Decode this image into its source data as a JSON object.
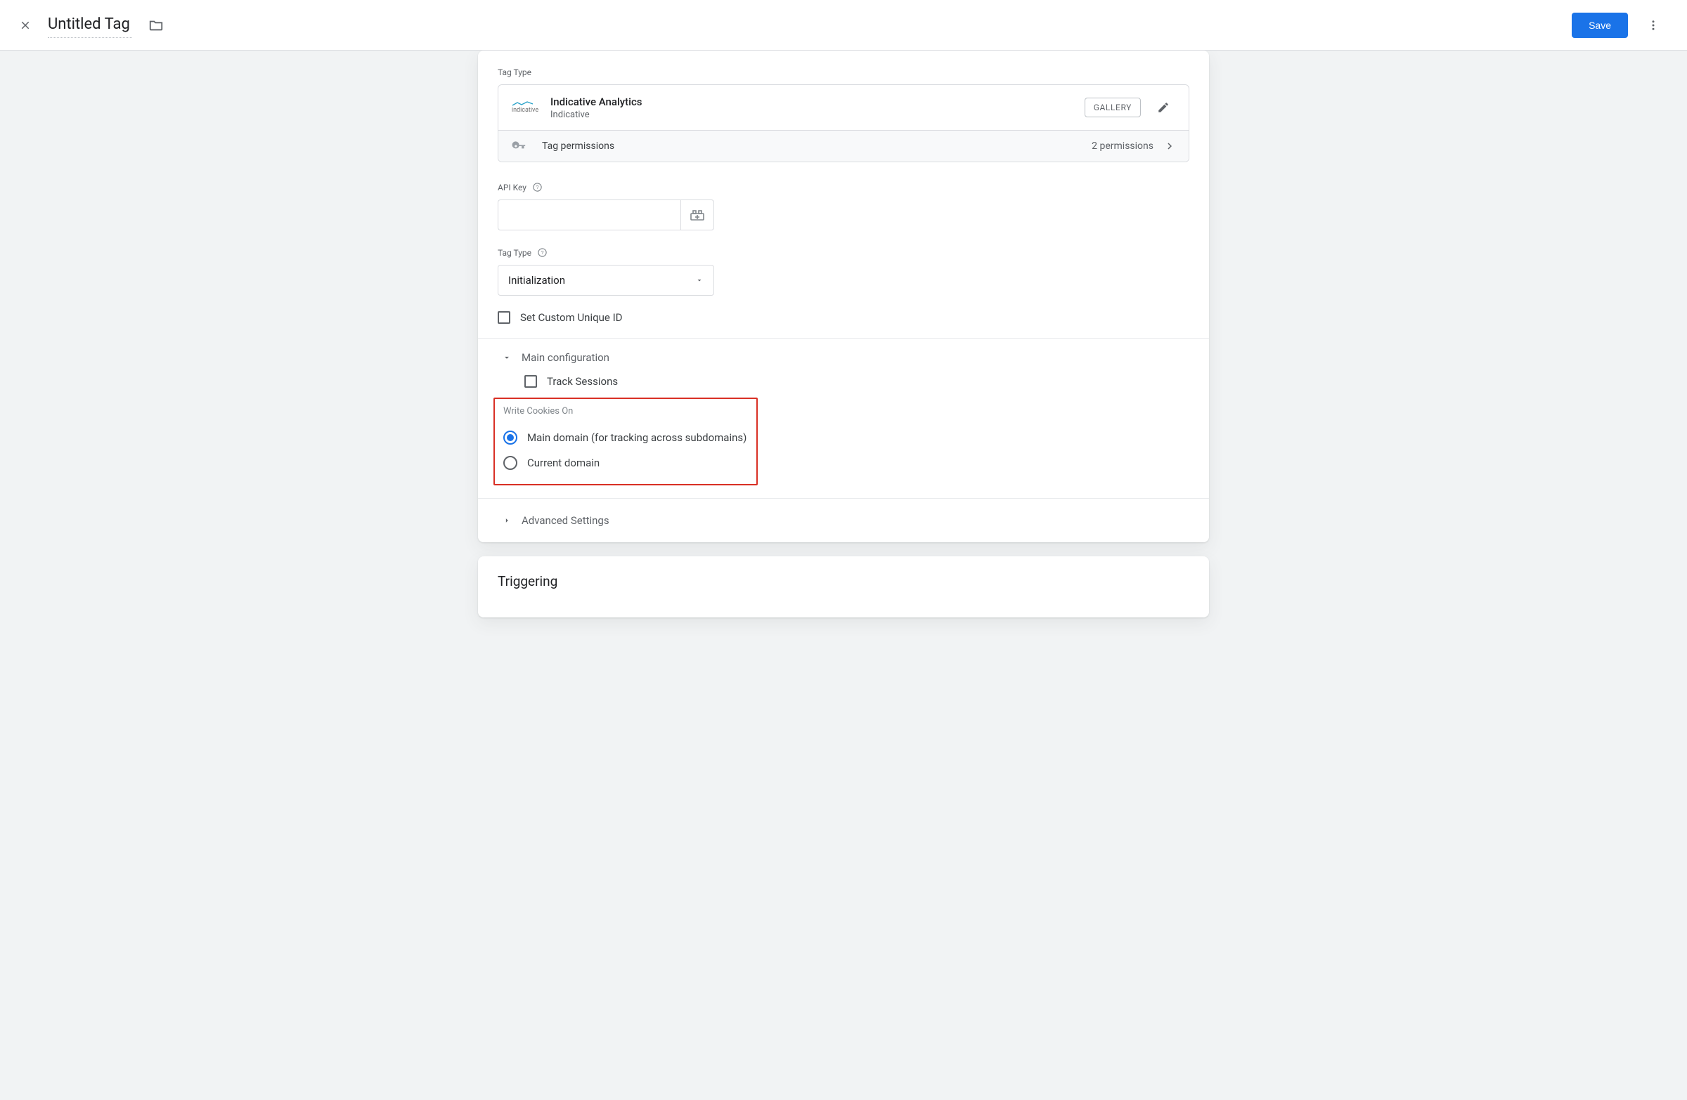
{
  "header": {
    "title": "Untitled Tag",
    "save_label": "Save"
  },
  "config": {
    "section_label": "Tag Type",
    "tag_name": "Indicative Analytics",
    "tag_vendor": "Indicative",
    "gallery_label": "Gallery",
    "perm_label": "Tag permissions",
    "perm_count": "2 permissions",
    "api_key_label": "API Key",
    "api_key_value": "",
    "tag_type_label": "Tag Type",
    "tag_type_value": "Initialization",
    "set_unique_label": "Set Custom Unique ID",
    "main_config_label": "Main configuration",
    "track_sessions_label": "Track Sessions",
    "cookies_label": "Write Cookies On",
    "cookies_opt1": "Main domain (for tracking across subdomains)",
    "cookies_opt2": "Current domain",
    "advanced_label": "Advanced Settings"
  },
  "triggering": {
    "title": "Triggering"
  }
}
